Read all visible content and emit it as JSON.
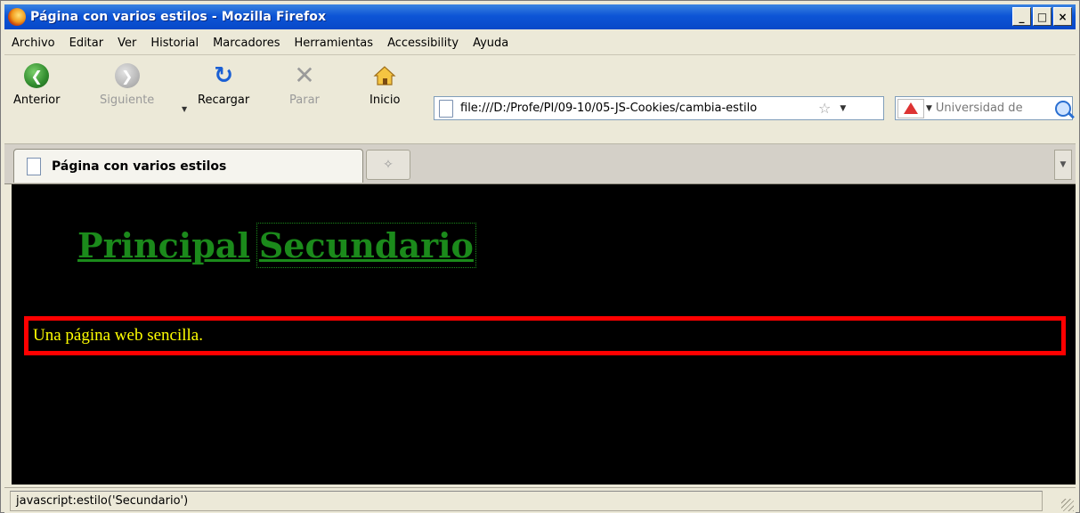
{
  "window": {
    "title": "Página con varios estilos - Mozilla Firefox",
    "controls": [
      "_",
      "□",
      "×"
    ]
  },
  "menu": [
    "Archivo",
    "Editar",
    "Ver",
    "Historial",
    "Marcadores",
    "Herramientas",
    "Accessibility",
    "Ayuda"
  ],
  "toolbar": {
    "back_label": "Anterior",
    "forward_label": "Siguiente",
    "reload_label": "Recargar",
    "stop_label": "Parar",
    "home_label": "Inicio",
    "url": "file:///D:/Profe/PI/09-10/05-JS-Cookies/cambia-estilo",
    "search_placeholder": "Universidad de"
  },
  "tabs": [
    {
      "label": "Página con varios estilos",
      "active": true
    }
  ],
  "page": {
    "link_principal": "Principal",
    "link_secundario": "Secundario",
    "box_text": "Una página web sencilla.",
    "colors": {
      "background": "#000000",
      "link": "#1b8a1b",
      "box_border": "#ff0000",
      "box_text": "#ffff00"
    }
  },
  "status": {
    "text": "javascript:estilo('Secundario')"
  }
}
